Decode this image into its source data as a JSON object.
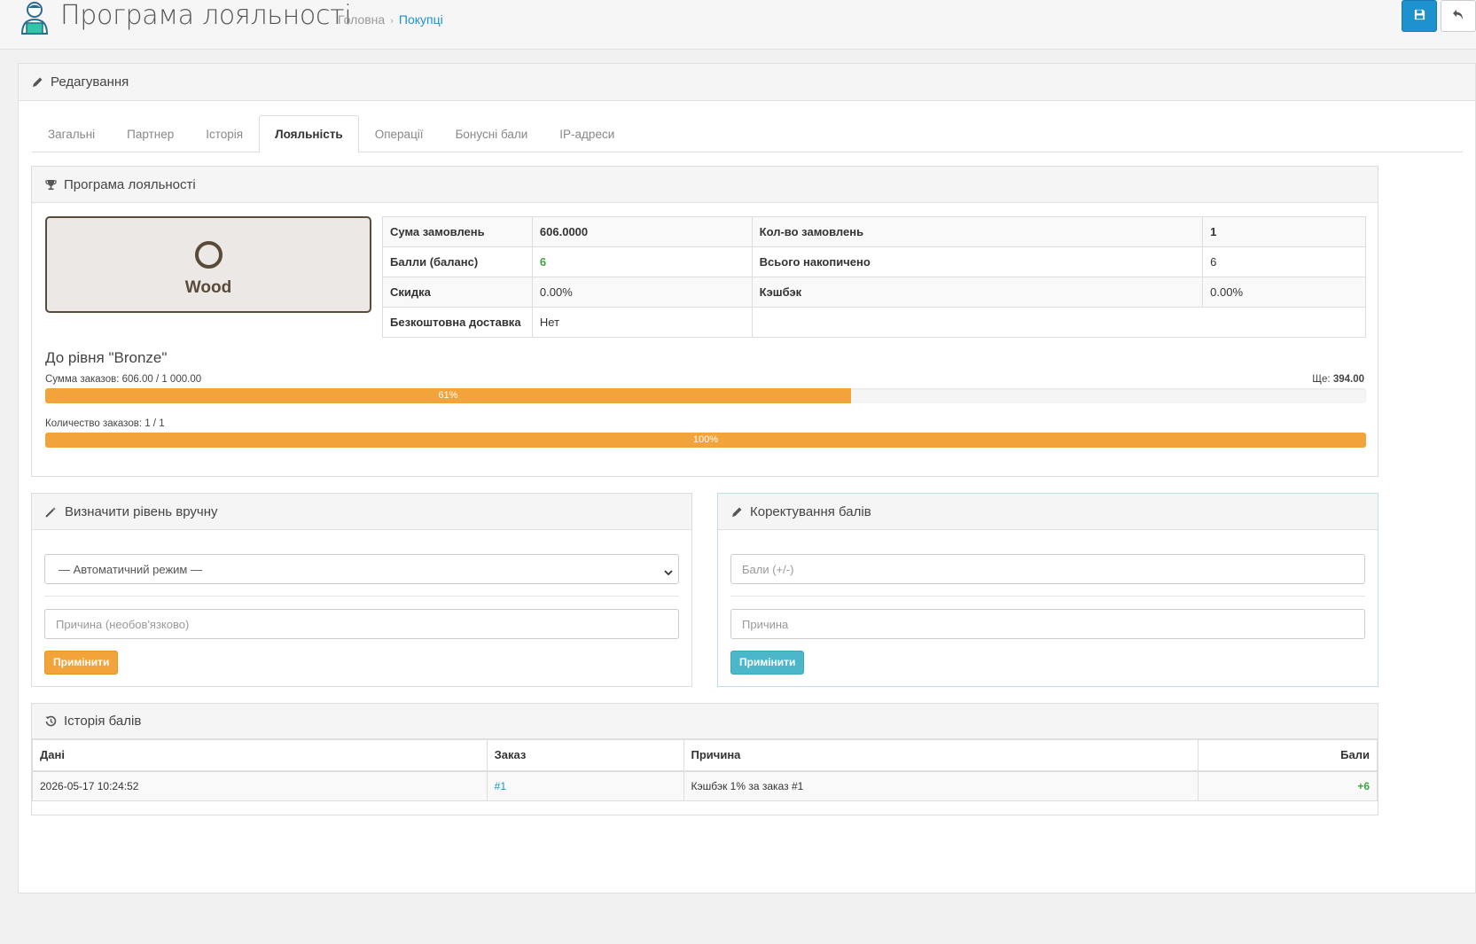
{
  "header": {
    "title": "Програма лояльності",
    "breadcrumb": [
      "Головна",
      "Покупці"
    ]
  },
  "panel": {
    "heading": "Редагування",
    "tabs": [
      {
        "label": "Загальні",
        "active": false
      },
      {
        "label": "Партнер",
        "active": false
      },
      {
        "label": "Історія",
        "active": false
      },
      {
        "label": "Лояльність",
        "active": true
      },
      {
        "label": "Операції",
        "active": false
      },
      {
        "label": "Бонусні бали",
        "active": false
      },
      {
        "label": "IP-адреси",
        "active": false
      }
    ]
  },
  "loyalty": {
    "heading": "Програма лояльності",
    "tier": "Wood",
    "tier_color": "#5a4a3a",
    "stats": {
      "orders_sum_label": "Сума замовлень",
      "orders_sum": "606.0000",
      "orders_count_label": "Кол-во замовлень",
      "orders_count": "1",
      "points_label": "Балли (баланс)",
      "points": "6",
      "total_label": "Всього накопичено",
      "total": "6",
      "discount_label": "Скидка",
      "discount": "0.00%",
      "cashback_label": "Кэшбэк",
      "cashback": "0.00%",
      "free_delivery_label": "Безкоштовна доставка",
      "free_delivery": "Нет"
    },
    "next_level": "До рівня \"Bronze\"",
    "progress_sum": {
      "label": "Сумма заказов: 606.00 / 1 000.00",
      "remaining_label": "Ще:",
      "remaining": "394.00",
      "percent": 61,
      "percent_label": "61%"
    },
    "progress_count": {
      "label": "Количество заказов: 1 / 1",
      "percent": 100,
      "percent_label": "100%"
    }
  },
  "manual_level": {
    "heading": "Визначити рівень вручну",
    "select_value": "— Автоматичний режим —",
    "reason_placeholder": "Причина (необов'язково)",
    "apply_label": "Примінити"
  },
  "points_adjust": {
    "heading": "Коректування балів",
    "points_placeholder": "Бали (+/-)",
    "reason_placeholder": "Причина",
    "apply_label": "Примінити"
  },
  "history": {
    "heading": "Історія балів",
    "columns": [
      "Дані",
      "Заказ",
      "Причина",
      "Бали"
    ],
    "rows": [
      {
        "date": "2026-05-17 10:24:52",
        "order": "#1",
        "reason": "Кэшбэк 1% за заказ #1",
        "points": "+6"
      }
    ]
  },
  "colors": {
    "primary": "#1e91cf",
    "warning": "#f2a33a",
    "info": "#4cb6cb",
    "success": "#3fa33f"
  }
}
